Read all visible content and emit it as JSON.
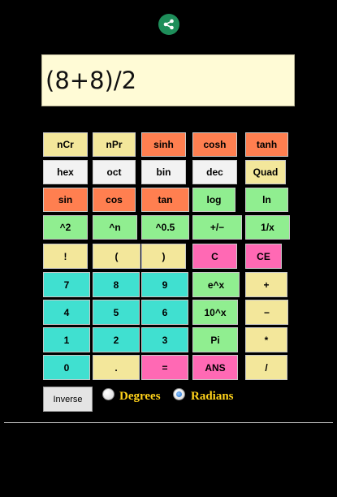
{
  "display": {
    "expression": "(8+8)/2"
  },
  "icons": {
    "share": "share-icon"
  },
  "colors": {
    "yellow": "#f3e79b",
    "white": "#f2f2f2",
    "orange": "#ff7f50",
    "green": "#90ee90",
    "pink": "#ff69b4",
    "teal": "#40e0d0",
    "share_bg": "#1e8e5a",
    "radio_label": "#ffd21a"
  },
  "keys": {
    "ncr": "nCr",
    "npr": "nPr",
    "sinh": "sinh",
    "cosh": "cosh",
    "tanh": "tanh",
    "hex": "hex",
    "oct": "oct",
    "bin": "bin",
    "dec": "dec",
    "quad": "Quad",
    "sin": "sin",
    "cos": "cos",
    "tan": "tan",
    "log": "log",
    "ln": "ln",
    "sq": "^2",
    "pow": "^n",
    "sqrt": "^0.5",
    "neg": "+/−",
    "recip": "1/x",
    "fact": "!",
    "lparen": "(",
    "rparen": ")",
    "clear": "C",
    "clear_entry": "CE",
    "d7": "7",
    "d8": "8",
    "d9": "9",
    "exp": "e^x",
    "plus": "+",
    "d4": "4",
    "d5": "5",
    "d6": "6",
    "pow10": "10^x",
    "minus": "−",
    "d1": "1",
    "d2": "2",
    "d3": "3",
    "pi": "Pi",
    "times": "*",
    "d0": "0",
    "dot": ".",
    "equals": "=",
    "ans": "ANS",
    "divide": "/"
  },
  "controls": {
    "inverse": "Inverse",
    "degrees": "Degrees",
    "radians": "Radians",
    "selected_mode": "Radians"
  }
}
